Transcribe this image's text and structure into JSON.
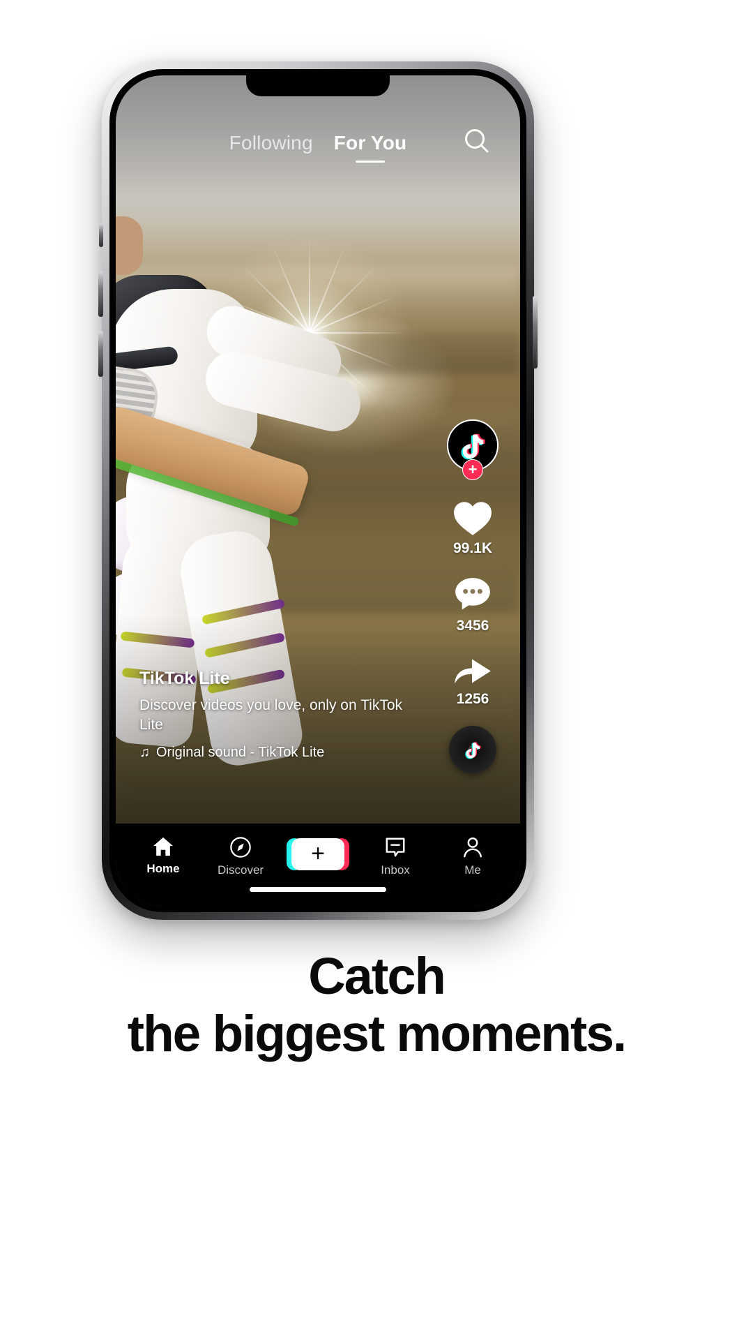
{
  "app": {
    "name": "TikTok Lite",
    "accent_pink": "#fe2c55",
    "accent_cyan": "#25f4ee"
  },
  "promo": {
    "headline_line1": "Catch",
    "headline_line2": "the biggest moments."
  },
  "topnav": {
    "following_label": "Following",
    "foryou_label": "For You",
    "active_tab": "For You",
    "search_icon": "search-icon"
  },
  "video": {
    "subject": "cricket-batsman-playing-shot",
    "caption": {
      "username": "TikTok Lite",
      "description": "Discover videos you love, only on TikTok Lite",
      "music_icon": "♫",
      "music_label": "Original sound - TikTok Lite"
    }
  },
  "rail": {
    "avatar_icon": "tiktok-note-logo",
    "follow_badge": "+",
    "items": [
      {
        "icon": "heart-icon",
        "count": "99.1K"
      },
      {
        "icon": "comment-icon",
        "count": "3456"
      },
      {
        "icon": "share-icon",
        "count": "1256"
      }
    ],
    "disc_icon": "music-disc-icon"
  },
  "tabbar": {
    "tabs": [
      {
        "label": "Home",
        "icon": "home-icon",
        "active": true
      },
      {
        "label": "Discover",
        "icon": "compass-icon",
        "active": false
      },
      {
        "label": "Inbox",
        "icon": "inbox-icon",
        "active": false
      },
      {
        "label": "Me",
        "icon": "person-icon",
        "active": false
      }
    ],
    "create_label": "+"
  }
}
